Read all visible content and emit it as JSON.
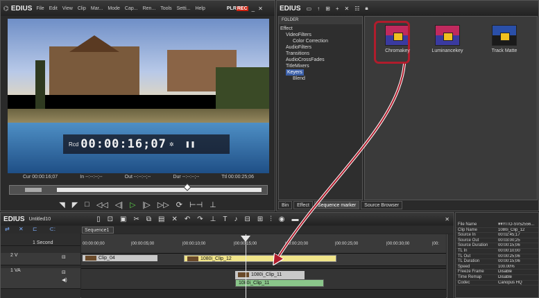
{
  "player": {
    "app": "EDIUS",
    "menu": [
      "File",
      "Edit",
      "View",
      "Clip",
      "Mar...",
      "Mode",
      "Cap...",
      "Ren...",
      "Tools",
      "Setti...",
      "Help"
    ],
    "badge_plr": "PLR",
    "badge_rec": "REC",
    "rcd_label": "Rcd",
    "timecode": "00:00:16;07",
    "cur": "Cur 00:00:16;07",
    "in": "In --:--:--;--",
    "out": "Out --:--:--;--",
    "dur": "Dur --:--:--;--",
    "ttl": "Ttl 00:00:25;06"
  },
  "palette": {
    "app": "EDIUS",
    "folder_header": "FOLDER",
    "tree": [
      "Effect",
      "VideoFilters",
      "Color Correction",
      "AudioFilters",
      "Transitions",
      "AudioCrossFades",
      "TitleMixers",
      "Keyers",
      "Blend"
    ],
    "effects": [
      "Chromakey",
      "Luminancekey",
      "Track Matte"
    ],
    "tabs": [
      "Bin",
      "Effect",
      "Sequence marker",
      "Source Browser"
    ]
  },
  "timeline": {
    "app": "EDIUS",
    "project": "Untitled10",
    "sequence_tab": "Sequence1",
    "scale": "1 Second",
    "ticks": [
      "00:00:00;00",
      "|00:00:05;00",
      "|00:00:10;00",
      "|00:00:15;00",
      "|00:00:20;00",
      "|00:00:25;00",
      "|00:00:30;00",
      "|00:"
    ],
    "tracks": [
      {
        "name": "2 V"
      },
      {
        "name": "1 VA"
      }
    ],
    "clips": {
      "clip04": "Clip_04",
      "clip12": "1080i_Clip_12",
      "clip11_v": "1080i_Clip_11",
      "clip11_a": "1080i_Clip_11"
    }
  },
  "info": {
    "rows": [
      [
        "File Name",
        "¥¥YITO-SV52556..."
      ],
      [
        "Clip Name",
        "1080i_Clip_12"
      ],
      [
        "Source In",
        "00:02:45;17"
      ],
      [
        "Source Out",
        "00:03:00;25"
      ],
      [
        "Source Duration",
        "00:00:15;06"
      ],
      [
        "TL In",
        "00:00:10;00"
      ],
      [
        "TL Out",
        "00:00:25;06"
      ],
      [
        "TL Duration",
        "00:00:15;06"
      ],
      [
        "Speed",
        "100.00%"
      ],
      [
        "Freeze Frame",
        "Disable"
      ],
      [
        "Time Remap",
        "Disable"
      ],
      [
        "Codec",
        "Canopus HQ"
      ]
    ]
  },
  "colors": {
    "highlight": "#b01c2c",
    "play": "#5cd04a",
    "selection": "#3b5fa8"
  }
}
